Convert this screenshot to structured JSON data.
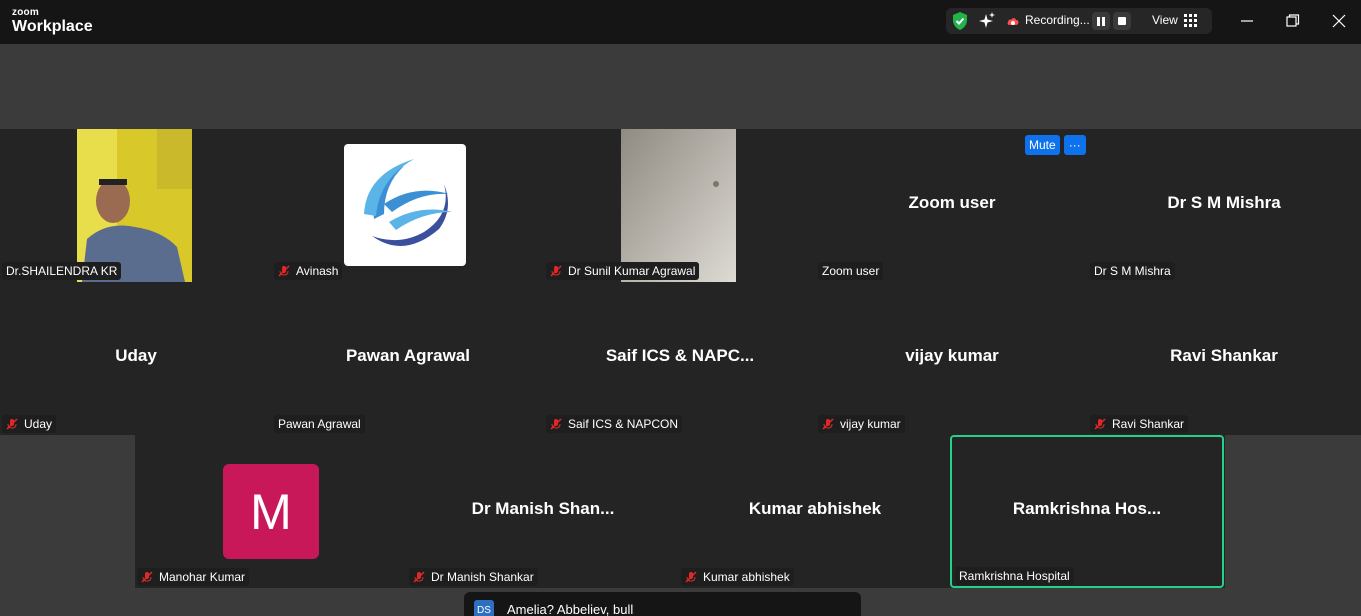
{
  "app": {
    "brand_small": "zoom",
    "brand_name": "Workplace"
  },
  "status_bar": {
    "recording_label": "Recording...",
    "view_label": "View",
    "icons": [
      "shield-check-icon",
      "ai-sparkle-icon",
      "cloud-record-icon",
      "pause-icon",
      "stop-icon",
      "grid-view-icon"
    ]
  },
  "window_controls": [
    "minimize-icon",
    "restore-icon",
    "close-icon"
  ],
  "participants": [
    {
      "label": "Dr.SHAILENDRA KR",
      "muted": false,
      "display": "video"
    },
    {
      "label": "Avinash",
      "muted": true,
      "display": "logo"
    },
    {
      "label": "Dr Sunil Kumar Agrawal",
      "muted": true,
      "display": "video"
    },
    {
      "name": "Zoom user",
      "label": "Zoom user",
      "muted": false,
      "display": "name"
    },
    {
      "name": "Dr S M Mishra",
      "label": "Dr S M Mishra",
      "muted": false,
      "display": "name"
    },
    {
      "name": "Uday",
      "label": "Uday",
      "muted": true,
      "display": "name"
    },
    {
      "name": "Pawan Agrawal",
      "label": "Pawan Agrawal",
      "muted": false,
      "display": "name"
    },
    {
      "name": "Saif ICS & NAPC...",
      "label": "Saif ICS & NAPCON",
      "muted": true,
      "display": "name"
    },
    {
      "name": "vijay kumar",
      "label": "vijay kumar",
      "muted": true,
      "display": "name"
    },
    {
      "name": "Ravi Shankar",
      "label": "Ravi Shankar",
      "muted": true,
      "display": "name"
    },
    {
      "avatar_letter": "M",
      "label": "Manohar Kumar",
      "muted": true,
      "display": "avatar"
    },
    {
      "name": "Dr Manish Shan...",
      "label": "Dr Manish Shankar",
      "muted": true,
      "display": "name"
    },
    {
      "name": "Kumar abhishek",
      "label": "Kumar abhishek",
      "muted": true,
      "display": "name"
    },
    {
      "name": "Ramkrishna Hos...",
      "label": "Ramkrishna Hospital",
      "muted": false,
      "display": "name",
      "active_speaker": true
    }
  ],
  "tile_actions": {
    "mute_label": "Mute",
    "more_label": "···"
  },
  "chat_preview": {
    "avatar_initials": "DS",
    "message": "Amelia? Abbeliev, bull"
  },
  "colors": {
    "accent_blue": "#0e72ed",
    "active_speaker_border": "#23d18b",
    "avatar_m_bg": "#c8185a",
    "muted_mic": "#e02828"
  }
}
